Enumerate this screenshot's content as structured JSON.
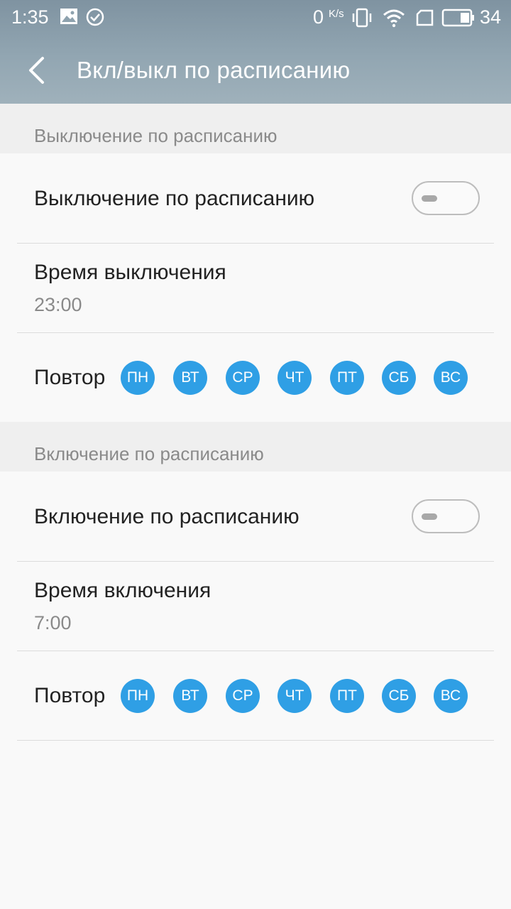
{
  "status_bar": {
    "time": "1:35",
    "net_speed_value": "0",
    "net_speed_unit": "K/s",
    "battery": "34",
    "icons": [
      "image-icon",
      "check-circle-icon",
      "vibrate-icon",
      "wifi-icon",
      "sim-icon",
      "battery-icon"
    ]
  },
  "appbar": {
    "back_icon": "back-arrow-icon",
    "title": "Вкл/выкл по расписанию"
  },
  "sections": [
    {
      "header": "Выключение по расписанию",
      "toggle_label": "Выключение по расписанию",
      "toggle_on": false,
      "time_label": "Время выключения",
      "time_value": "23:00",
      "repeat_label": "Повтор",
      "days": [
        "ПН",
        "ВТ",
        "СР",
        "ЧТ",
        "ПТ",
        "СБ",
        "ВС"
      ]
    },
    {
      "header": "Включение по расписанию",
      "toggle_label": "Включение по расписанию",
      "toggle_on": false,
      "time_label": "Время включения",
      "time_value": "7:00",
      "repeat_label": "Повтор",
      "days": [
        "ПН",
        "ВТ",
        "СР",
        "ЧТ",
        "ПТ",
        "СБ",
        "ВС"
      ]
    }
  ],
  "colors": {
    "accent": "#2f9fe5",
    "header_gradient_top": "#7f93a1",
    "header_gradient_bottom": "#9fb1bb",
    "section_header_bg": "#efefef"
  }
}
